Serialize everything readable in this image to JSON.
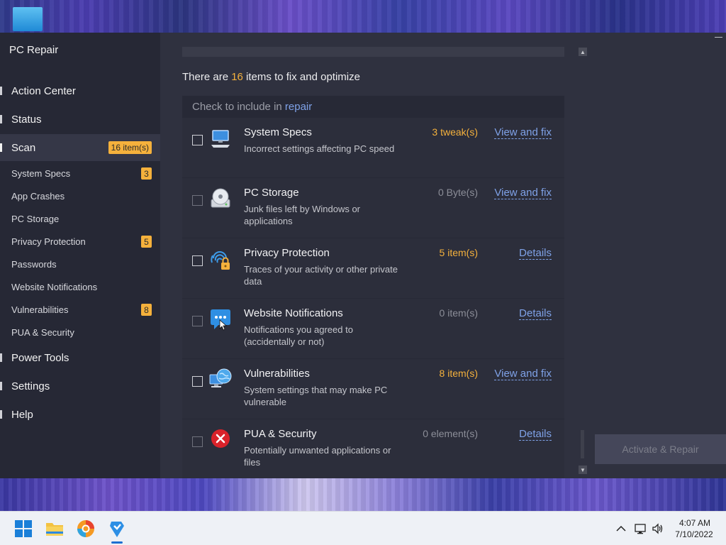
{
  "app": {
    "title": "PC Repair"
  },
  "sidebar": {
    "main_items": [
      {
        "label": "Action Center"
      },
      {
        "label": "Status"
      },
      {
        "label": "Scan",
        "badge": "16 item(s)"
      },
      {
        "label": "Power Tools"
      },
      {
        "label": "Settings"
      },
      {
        "label": "Help"
      }
    ],
    "sub_items": [
      {
        "label": "System Specs",
        "badge": "3"
      },
      {
        "label": "App Crashes"
      },
      {
        "label": "PC Storage"
      },
      {
        "label": "Privacy Protection",
        "badge": "5"
      },
      {
        "label": "Passwords"
      },
      {
        "label": "Website Notifications"
      },
      {
        "label": "Vulnerabilities",
        "badge": "8"
      },
      {
        "label": "PUA & Security"
      }
    ]
  },
  "summary": {
    "prefix": "There are ",
    "count": "16",
    "suffix": " items to fix and optimize"
  },
  "panel": {
    "header_prefix": "Check to include in ",
    "header_link": "repair"
  },
  "rows": [
    {
      "title": "System Specs",
      "desc": "Incorrect settings affecting PC speed",
      "count": "3 tweak(s)",
      "action": "View and fix",
      "checkbox_state": "unchecked",
      "icon": "computer-icon"
    },
    {
      "title": "PC Storage",
      "desc": "Junk files left by Windows or applications",
      "count": "0 Byte(s)",
      "action": "View and fix",
      "checkbox_state": "disabled",
      "icon": "disk-icon"
    },
    {
      "title": "Privacy Protection",
      "desc": "Traces of your activity or other private data",
      "count": "5 item(s)",
      "action": "Details",
      "checkbox_state": "unchecked",
      "icon": "fingerprint-lock-icon"
    },
    {
      "title": "Website Notifications",
      "desc": "Notifications you agreed to (accidentally or not)",
      "count": "0 item(s)",
      "action": "Details",
      "checkbox_state": "disabled",
      "icon": "chat-bubble-icon"
    },
    {
      "title": "Vulnerabilities",
      "desc": "System settings that may make PC vulnerable",
      "count": "8 item(s)",
      "action": "View and fix",
      "checkbox_state": "unchecked",
      "icon": "globe-computer-icon"
    },
    {
      "title": "PUA & Security",
      "desc": "Potentially unwanted applications or files",
      "count": "0 element(s)",
      "action": "Details",
      "checkbox_state": "disabled",
      "icon": "red-x-icon"
    }
  ],
  "activate_button": {
    "label": "Activate & Repair"
  },
  "taskbar": {
    "icons": [
      "windows-start-icon",
      "file-explorer-icon",
      "browser-icon",
      "pc-repair-app-icon"
    ],
    "tray_icons": [
      "chevron-up-icon",
      "network-icon",
      "volume-icon"
    ],
    "time": "4:07 AM",
    "date": "7/10/2022"
  },
  "colors": {
    "accent": "#f5b13c",
    "link": "#7fa2e8",
    "sidebar_bg": "#262835",
    "panel_bg": "#272936",
    "row_bg": "#2c2e3b"
  }
}
